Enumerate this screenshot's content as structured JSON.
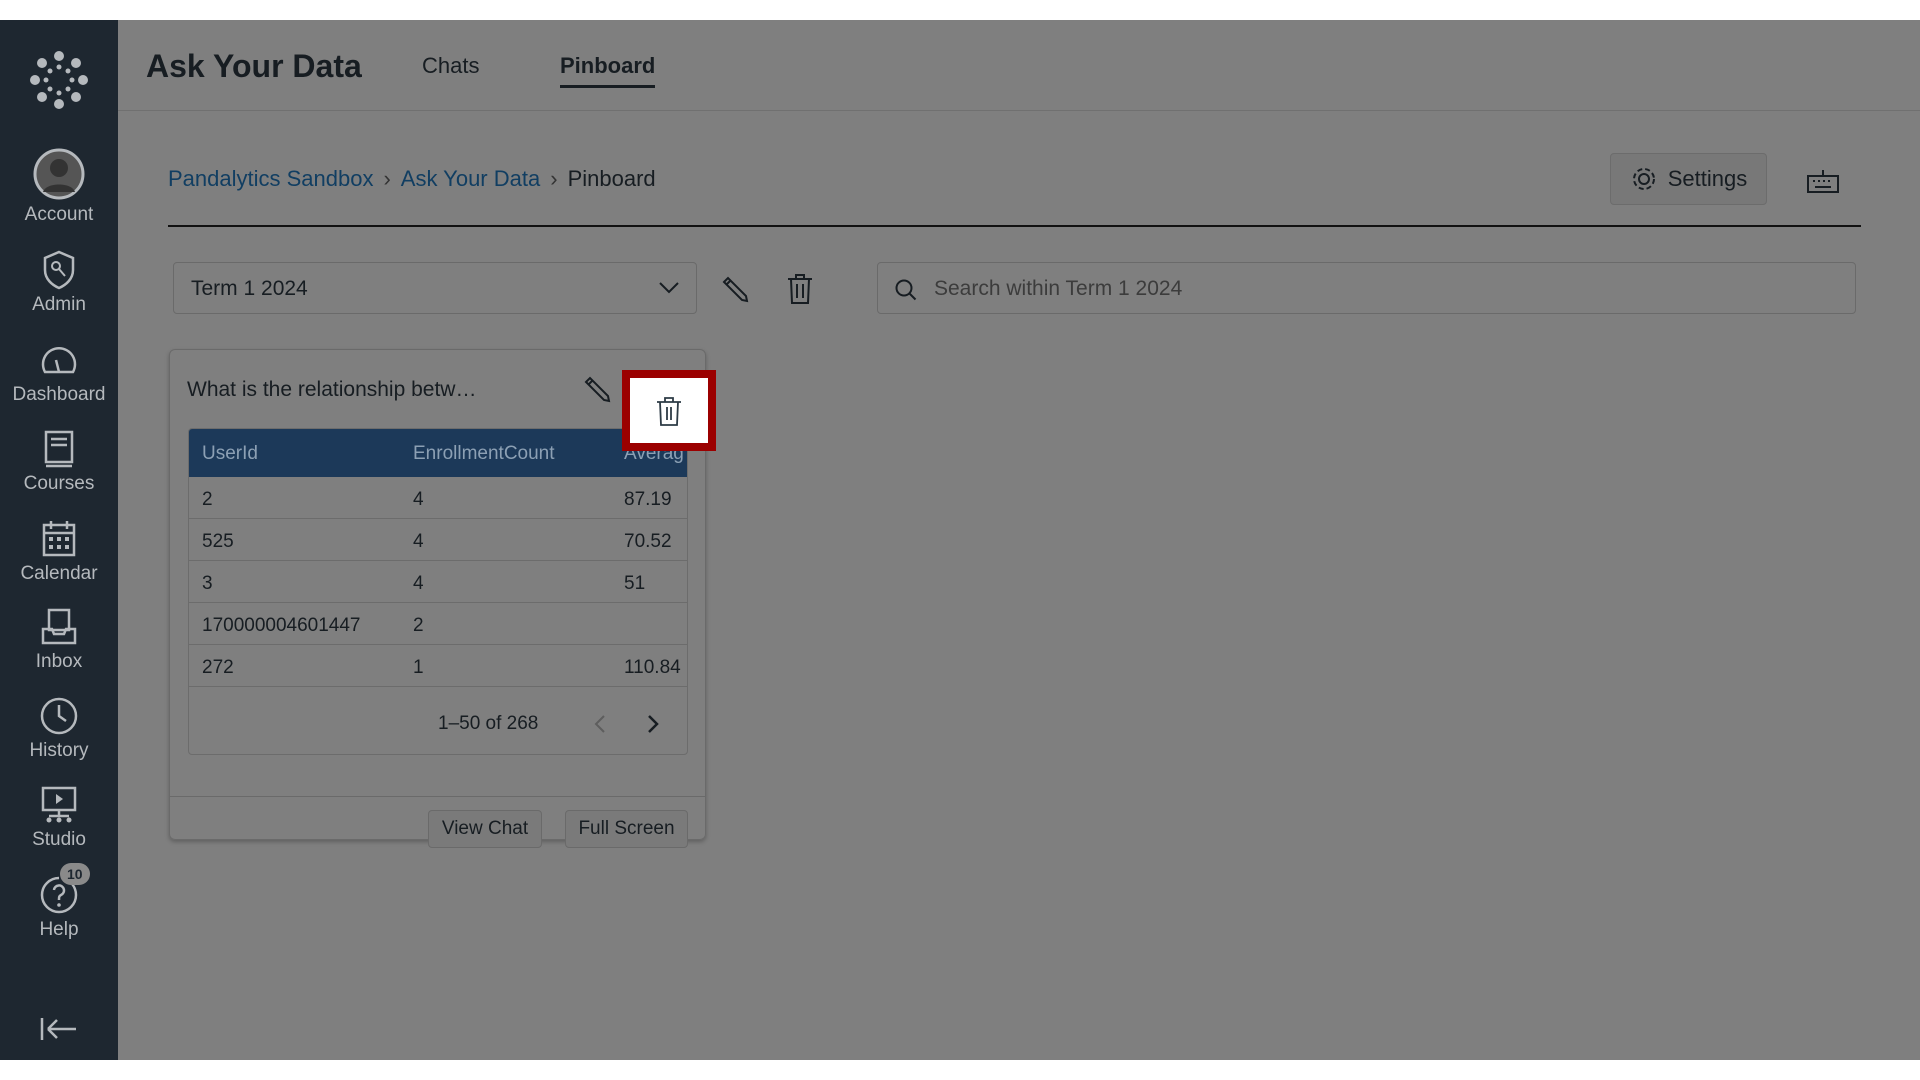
{
  "sidebar": {
    "items": [
      {
        "label": "Account",
        "icon": "account-icon"
      },
      {
        "label": "Admin",
        "icon": "admin-icon"
      },
      {
        "label": "Dashboard",
        "icon": "dashboard-icon"
      },
      {
        "label": "Courses",
        "icon": "courses-icon"
      },
      {
        "label": "Calendar",
        "icon": "calendar-icon"
      },
      {
        "label": "Inbox",
        "icon": "inbox-icon"
      },
      {
        "label": "History",
        "icon": "history-icon"
      },
      {
        "label": "Studio",
        "icon": "studio-icon"
      },
      {
        "label": "Help",
        "icon": "help-icon",
        "badge": "10"
      }
    ]
  },
  "header": {
    "title": "Ask Your Data",
    "tabs": [
      {
        "label": "Chats"
      },
      {
        "label": "Pinboard",
        "active": true
      }
    ]
  },
  "breadcrumb": [
    "Pandalytics Sandbox",
    "Ask Your Data",
    "Pinboard"
  ],
  "settings_label": "Settings",
  "term_select": {
    "value": "Term 1 2024"
  },
  "search": {
    "placeholder": "Search within Term 1 2024"
  },
  "card": {
    "title": "What is the relationship betw…",
    "columns": [
      "UserId",
      "EnrollmentCount",
      "Averag"
    ],
    "rows": [
      [
        "2",
        "4",
        "87.19"
      ],
      [
        "525",
        "4",
        "70.52"
      ],
      [
        "3",
        "4",
        "51"
      ],
      [
        "170000004601447",
        "2",
        ""
      ],
      [
        "272",
        "1",
        "110.84"
      ]
    ],
    "pagination": "1–50 of 268",
    "view_chat": "View Chat",
    "full_screen": "Full Screen"
  },
  "colors": {
    "highlight": "#9b0000",
    "table_header": "#1c3959",
    "overlay": "#7f7f7f"
  }
}
